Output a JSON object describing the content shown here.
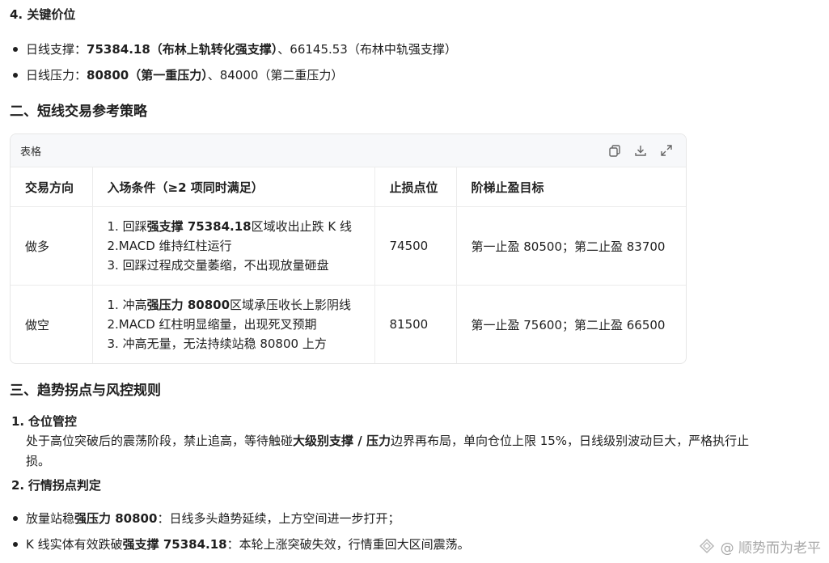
{
  "section4": {
    "title": "4. 关键价位",
    "bullets": [
      {
        "prefix": "日线支撑：",
        "bold": "75384.18（布林上轨转化强支撑）",
        "suffix": "、66145.53（布林中轨强支撑）"
      },
      {
        "prefix": "日线压力：",
        "bold": "80800（第一重压力）",
        "suffix": "、84000（第二重压力）"
      }
    ]
  },
  "section2": {
    "title": "二、短线交易参考策略"
  },
  "table": {
    "label": "表格",
    "icons": [
      "copy-icon",
      "download-icon",
      "expand-icon"
    ],
    "headers": [
      "交易方向",
      "入场条件（≥2 项同时满足）",
      "止损点位",
      "阶梯止盈目标"
    ],
    "rows": [
      {
        "direction": "做多",
        "cond1_pre": "1. 回踩",
        "cond1_bold": "强支撑 75384.18",
        "cond1_post": "区域收出止跌 K 线",
        "cond2": "2.MACD 维持红柱运行",
        "cond3": "3. 回踩过程成交量萎缩，不出现放量砸盘",
        "stop": "74500",
        "target": "第一止盈 80500；第二止盈 83700"
      },
      {
        "direction": "做空",
        "cond1_pre": "1. 冲高",
        "cond1_bold": "强压力 80800",
        "cond1_post": "区域承压收长上影阴线",
        "cond2": "2.MACD 红柱明显缩量，出现死叉预期",
        "cond3": "3. 冲高无量，无法持续站稳 80800 上方",
        "stop": "81500",
        "target": "第一止盈 75600；第二止盈 66500"
      }
    ]
  },
  "section3": {
    "title": "三、趋势拐点与风控规则",
    "item1": {
      "num": "1.",
      "title": "仓位管控",
      "line1_pre": "处于高位突破后的震荡阶段，禁止追高，等待触碰",
      "line1_bold": "大级别支撑 / 压力",
      "line1_post": "边界再布局，单向仓位上限 15%，日线级别波动巨大，严格执行止",
      "line2": "损。"
    },
    "item2": {
      "num": "2.",
      "title": "行情拐点判定"
    },
    "bullets": [
      {
        "prefix": "放量站稳",
        "bold": "强压力 80800",
        "suffix": "：日线多头趋势延续，上方空间进一步打开；"
      },
      {
        "prefix": "K 线实体有效跌破",
        "bold": "强支撑 75384.18",
        "suffix": "：本轮上涨突破失效，行情重回大区间震荡。"
      }
    ]
  },
  "watermark": {
    "text": "@ 顺势而为老平"
  }
}
